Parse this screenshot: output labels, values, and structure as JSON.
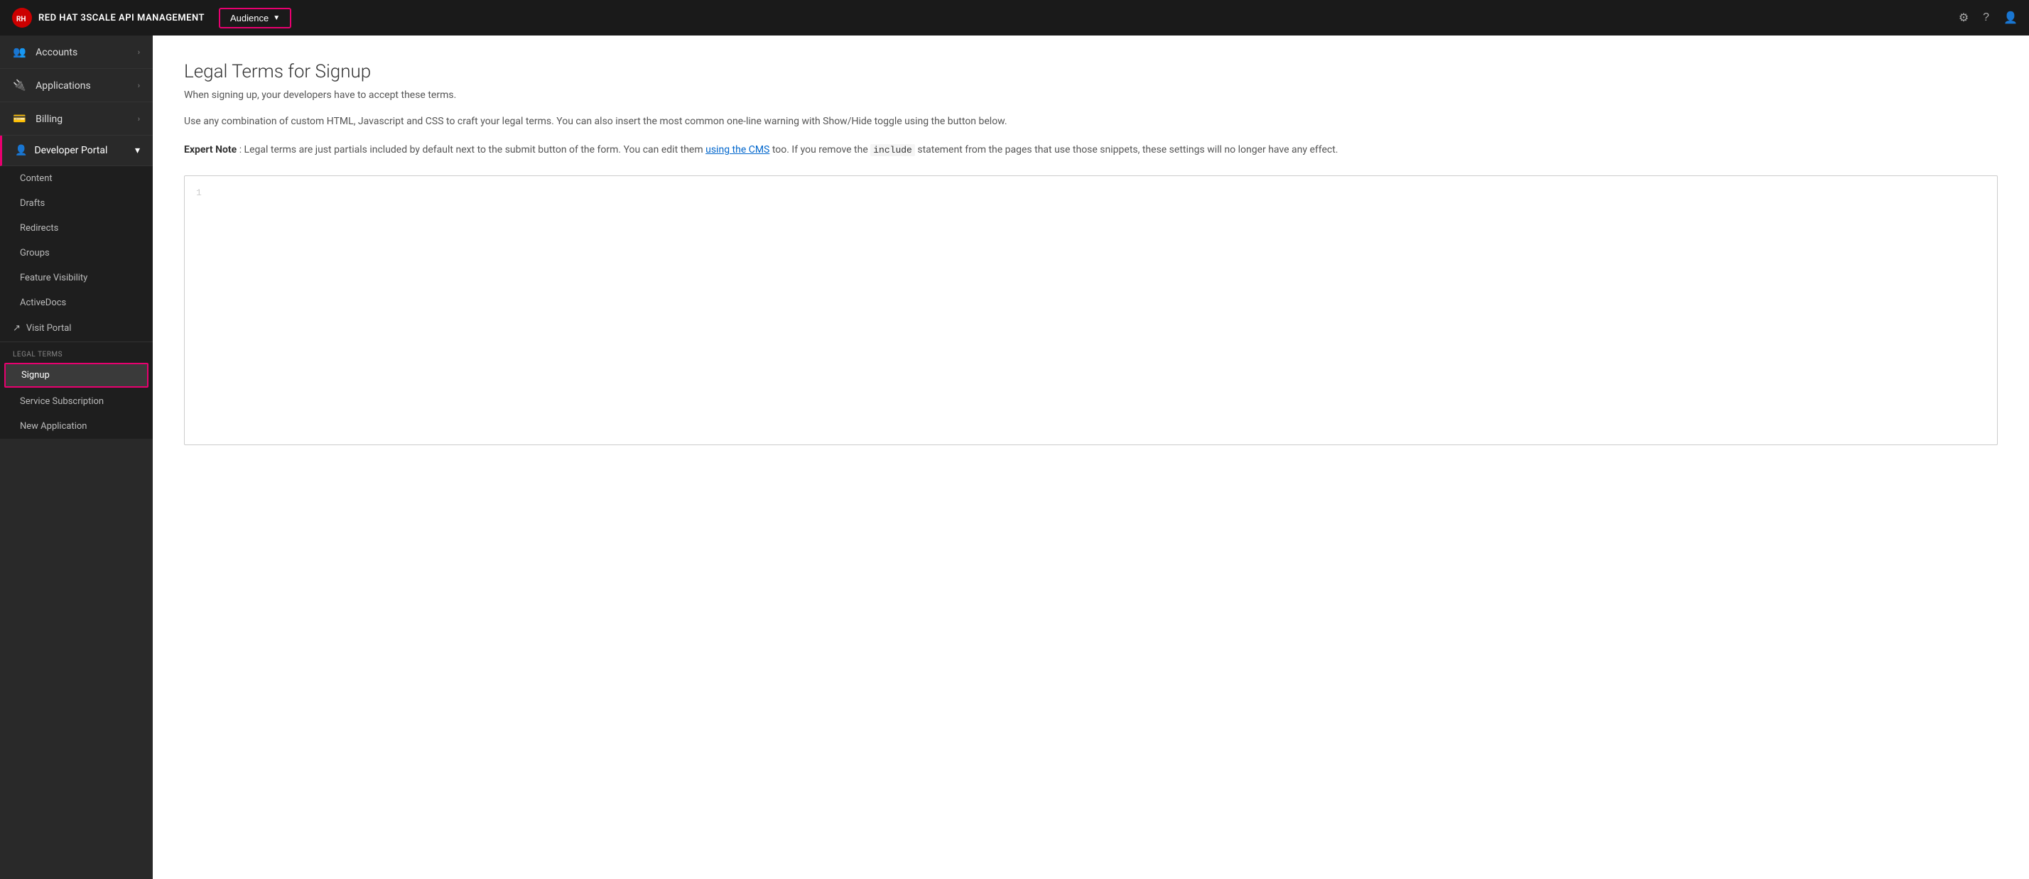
{
  "topNav": {
    "brand": "RED HAT 3SCALE API MANAGEMENT",
    "audienceLabel": "Audience",
    "icons": {
      "settings": "⚙",
      "help": "?",
      "user": "👤"
    }
  },
  "sidebar": {
    "items": [
      {
        "id": "accounts",
        "label": "Accounts",
        "icon": "👥"
      },
      {
        "id": "applications",
        "label": "Applications",
        "icon": "🔌"
      },
      {
        "id": "billing",
        "label": "Billing",
        "icon": "💳"
      },
      {
        "id": "developer-portal",
        "label": "Developer Portal",
        "icon": "👤",
        "active": true
      }
    ],
    "developerPortalSub": [
      {
        "id": "content",
        "label": "Content"
      },
      {
        "id": "drafts",
        "label": "Drafts"
      },
      {
        "id": "redirects",
        "label": "Redirects"
      },
      {
        "id": "groups",
        "label": "Groups"
      },
      {
        "id": "feature-visibility",
        "label": "Feature Visibility"
      },
      {
        "id": "activedocs",
        "label": "ActiveDocs"
      }
    ],
    "visitPortal": "Visit Portal",
    "legalTermsLabel": "Legal Terms",
    "legalTermsItems": [
      {
        "id": "signup",
        "label": "Signup",
        "active": true
      },
      {
        "id": "service-subscription",
        "label": "Service Subscription"
      },
      {
        "id": "new-application",
        "label": "New Application"
      }
    ]
  },
  "mainContent": {
    "title": "Legal Terms for Signup",
    "subtitle": "When signing up, your developers have to accept these terms.",
    "description": "Use any combination of custom HTML, Javascript and CSS to craft your legal terms. You can also insert the most common one-line warning with Show/Hide toggle using the button below.",
    "expertNote": {
      "prefix": "Expert Note",
      "text": ": Legal terms are just partials included by default next to the submit button of the form. You can edit them ",
      "linkText": "using the CMS",
      "suffix": " too. If you remove the ",
      "codeText": "include",
      "suffix2": " statement from the pages that use those snippets, these settings will no longer have any effect."
    },
    "editor": {
      "lineNumber": "1"
    }
  }
}
